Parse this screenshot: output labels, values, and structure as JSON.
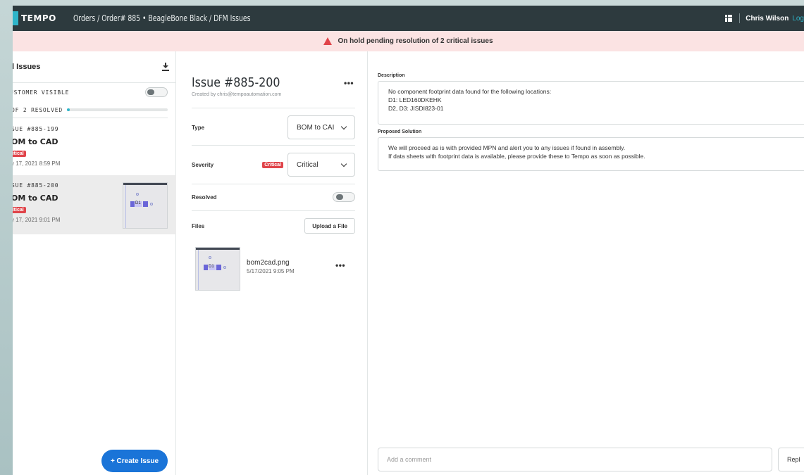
{
  "header": {
    "logo": "TEMPO",
    "breadcrumb": "Orders / Order# 885 • BeagleBone Black / DFM Issues",
    "user_name": "Chris Wilson",
    "logout_label": "Log"
  },
  "alert": {
    "message": "On hold pending resolution of 2 critical issues"
  },
  "issues_panel": {
    "title": "ll Issues",
    "customer_visible_label": "USTOMER VISIBLE",
    "resolved_label": "OF 2 RESOLVED",
    "resolved_fraction": 0.0,
    "issues": [
      {
        "id": "SUE #885-199",
        "title": "OM to CAD",
        "severity": "ritical",
        "date": "y 17, 2021 8:59 PM"
      },
      {
        "id": "SUE #885-200",
        "title": "OM to CAD",
        "severity": "ritical",
        "date": "y 17, 2021 9:01 PM",
        "thumb_label": "D1"
      }
    ],
    "create_button": "+ Create Issue"
  },
  "detail": {
    "title": "Issue #885-200",
    "created_by": "Created by chris@tempoautomation.com",
    "type_label": "Type",
    "type_value": "BOM to CAI",
    "severity_label": "Severity",
    "severity_badge": "Critical",
    "severity_value": "Critical",
    "resolved_label": "Resolved",
    "files_label": "Files",
    "upload_button": "Upload a File",
    "file": {
      "name": "bom2cad.png",
      "date": "5/17/2021 9:05 PM",
      "thumb_label": "D1"
    },
    "menu_dots": "•••"
  },
  "right": {
    "description_label": "Description",
    "description_lines": [
      "No component footprint data found for the following locations:",
      "D1: LED160DKEHK",
      "D2, D3: JISDI823-01"
    ],
    "solution_label": "Proposed Solution",
    "solution_lines": [
      "We will proceed as is with provided MPN and alert you to any issues if found in assembly.",
      "If data sheets with footprint data is available, please provide these to Tempo as soon as possible."
    ],
    "comment_placeholder": "Add a comment",
    "reply_button": "Repl"
  }
}
